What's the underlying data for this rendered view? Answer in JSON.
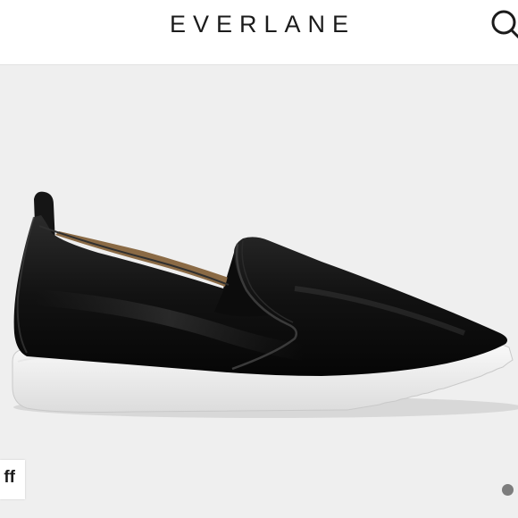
{
  "header": {
    "brand": "EVERLANE",
    "search_icon": "search-icon"
  },
  "product": {
    "image_alt_icon": "black-leather-slip-on-shoe-image"
  },
  "badge": {
    "text": "ff"
  },
  "carousel": {
    "dot_icon": "carousel-dot-icon",
    "active_color": "#7d7d7d"
  }
}
